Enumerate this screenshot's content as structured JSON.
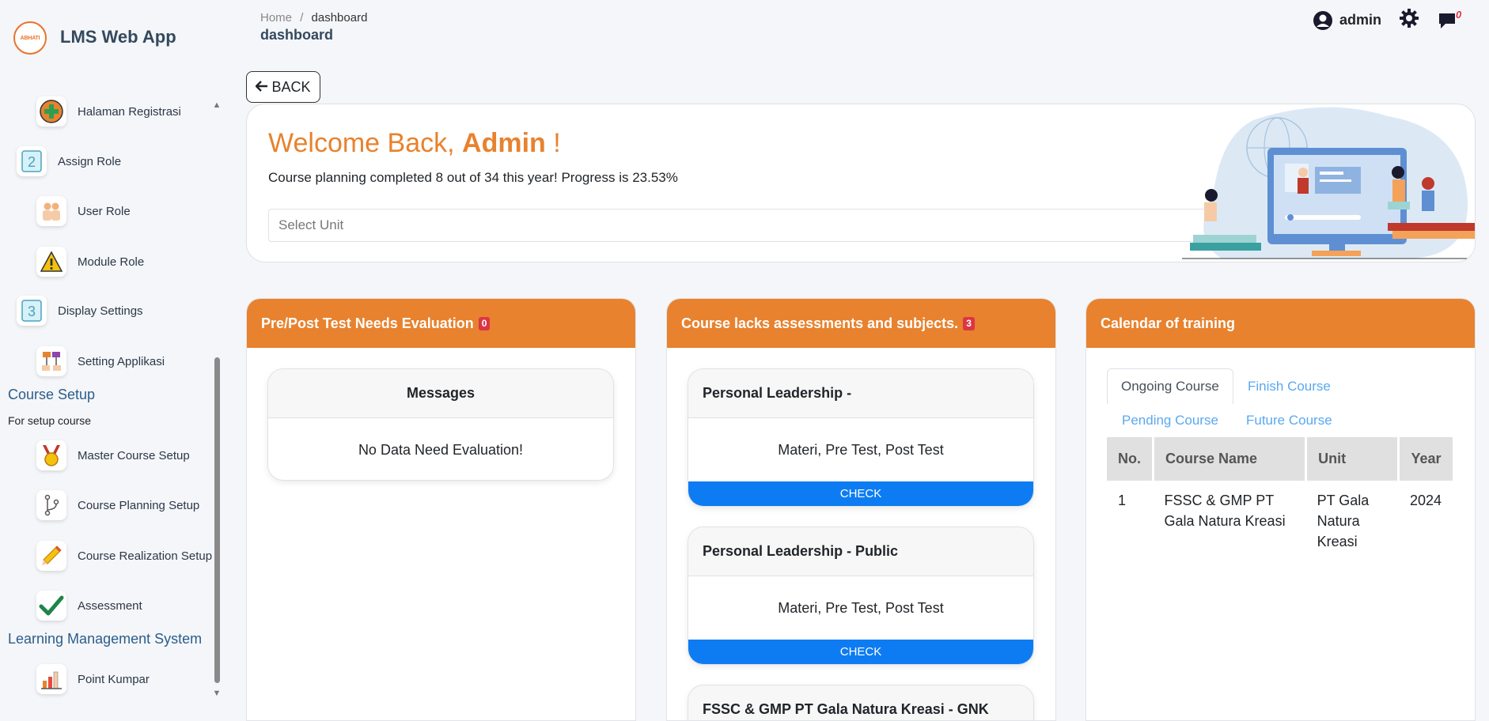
{
  "app": {
    "logo_text": "ABHATI",
    "title": "LMS Web App"
  },
  "sidebar": {
    "items": [
      {
        "label": "Halaman Registrasi",
        "icon": "plus-circle-icon"
      },
      {
        "label": "Assign Role",
        "icon": "number-2-icon"
      },
      {
        "label": "User Role",
        "icon": "users-icon"
      },
      {
        "label": "Module Role",
        "icon": "warning-icon"
      },
      {
        "label": "Display Settings",
        "icon": "number-3-icon"
      },
      {
        "label": "Setting Applikasi",
        "icon": "sitemap-icon"
      },
      {
        "label": "Master Course Setup",
        "icon": "medal-icon"
      },
      {
        "label": "Course Planning Setup",
        "icon": "branch-icon"
      },
      {
        "label": "Course Realization Setup",
        "icon": "pencil-icon"
      },
      {
        "label": "Assessment",
        "icon": "checkmark-icon"
      },
      {
        "label": "Point Kumpar",
        "icon": "bar-chart-icon"
      }
    ],
    "sections": {
      "course_setup": {
        "title": "Course Setup",
        "subtitle": "For setup course"
      },
      "lms": {
        "title": "Learning Management System"
      }
    }
  },
  "header": {
    "breadcrumb_home": "Home",
    "breadcrumb_sep": "/",
    "breadcrumb_current": "dashboard",
    "page_title": "dashboard",
    "user": "admin",
    "notification_count": "0"
  },
  "back_label": "BACK",
  "welcome": {
    "greeting": "Welcome Back, ",
    "name": "Admin",
    "exclaim": " !",
    "progress": "Course planning completed 8 out of 34 this year! Progress is 23.53%",
    "progress_value": 23.53,
    "unit_placeholder": "Select Unit"
  },
  "panels": {
    "evaluation": {
      "title": "Pre/Post Test Needs Evaluation",
      "count": "0",
      "card_title": "Messages",
      "card_body": "No Data Need Evaluation!"
    },
    "lacks": {
      "title": "Course lacks assessments and subjects.",
      "count": "3",
      "cards": [
        {
          "title": "Personal Leadership -",
          "body": "Materi, Pre Test, Post Test",
          "button": "CHECK"
        },
        {
          "title": "Personal Leadership - Public",
          "body": "Materi, Pre Test, Post Test",
          "button": "CHECK"
        },
        {
          "title": "FSSC & GMP PT Gala Natura Kreasi - GNK"
        }
      ]
    },
    "calendar": {
      "title": "Calendar of training",
      "tabs": [
        "Ongoing Course",
        "Finish Course",
        "Pending Course",
        "Future Course"
      ],
      "columns": [
        "No.",
        "Course Name",
        "Unit",
        "Year"
      ],
      "rows": [
        {
          "no": "1",
          "course": "FSSC & GMP PT Gala Natura Kreasi",
          "unit": "PT Gala Natura Kreasi",
          "year": "2024"
        }
      ]
    }
  },
  "colors": {
    "accent": "#e8822e",
    "button": "#0d7cf2",
    "badge": "#dc3545",
    "section": "#2c5d8a"
  }
}
